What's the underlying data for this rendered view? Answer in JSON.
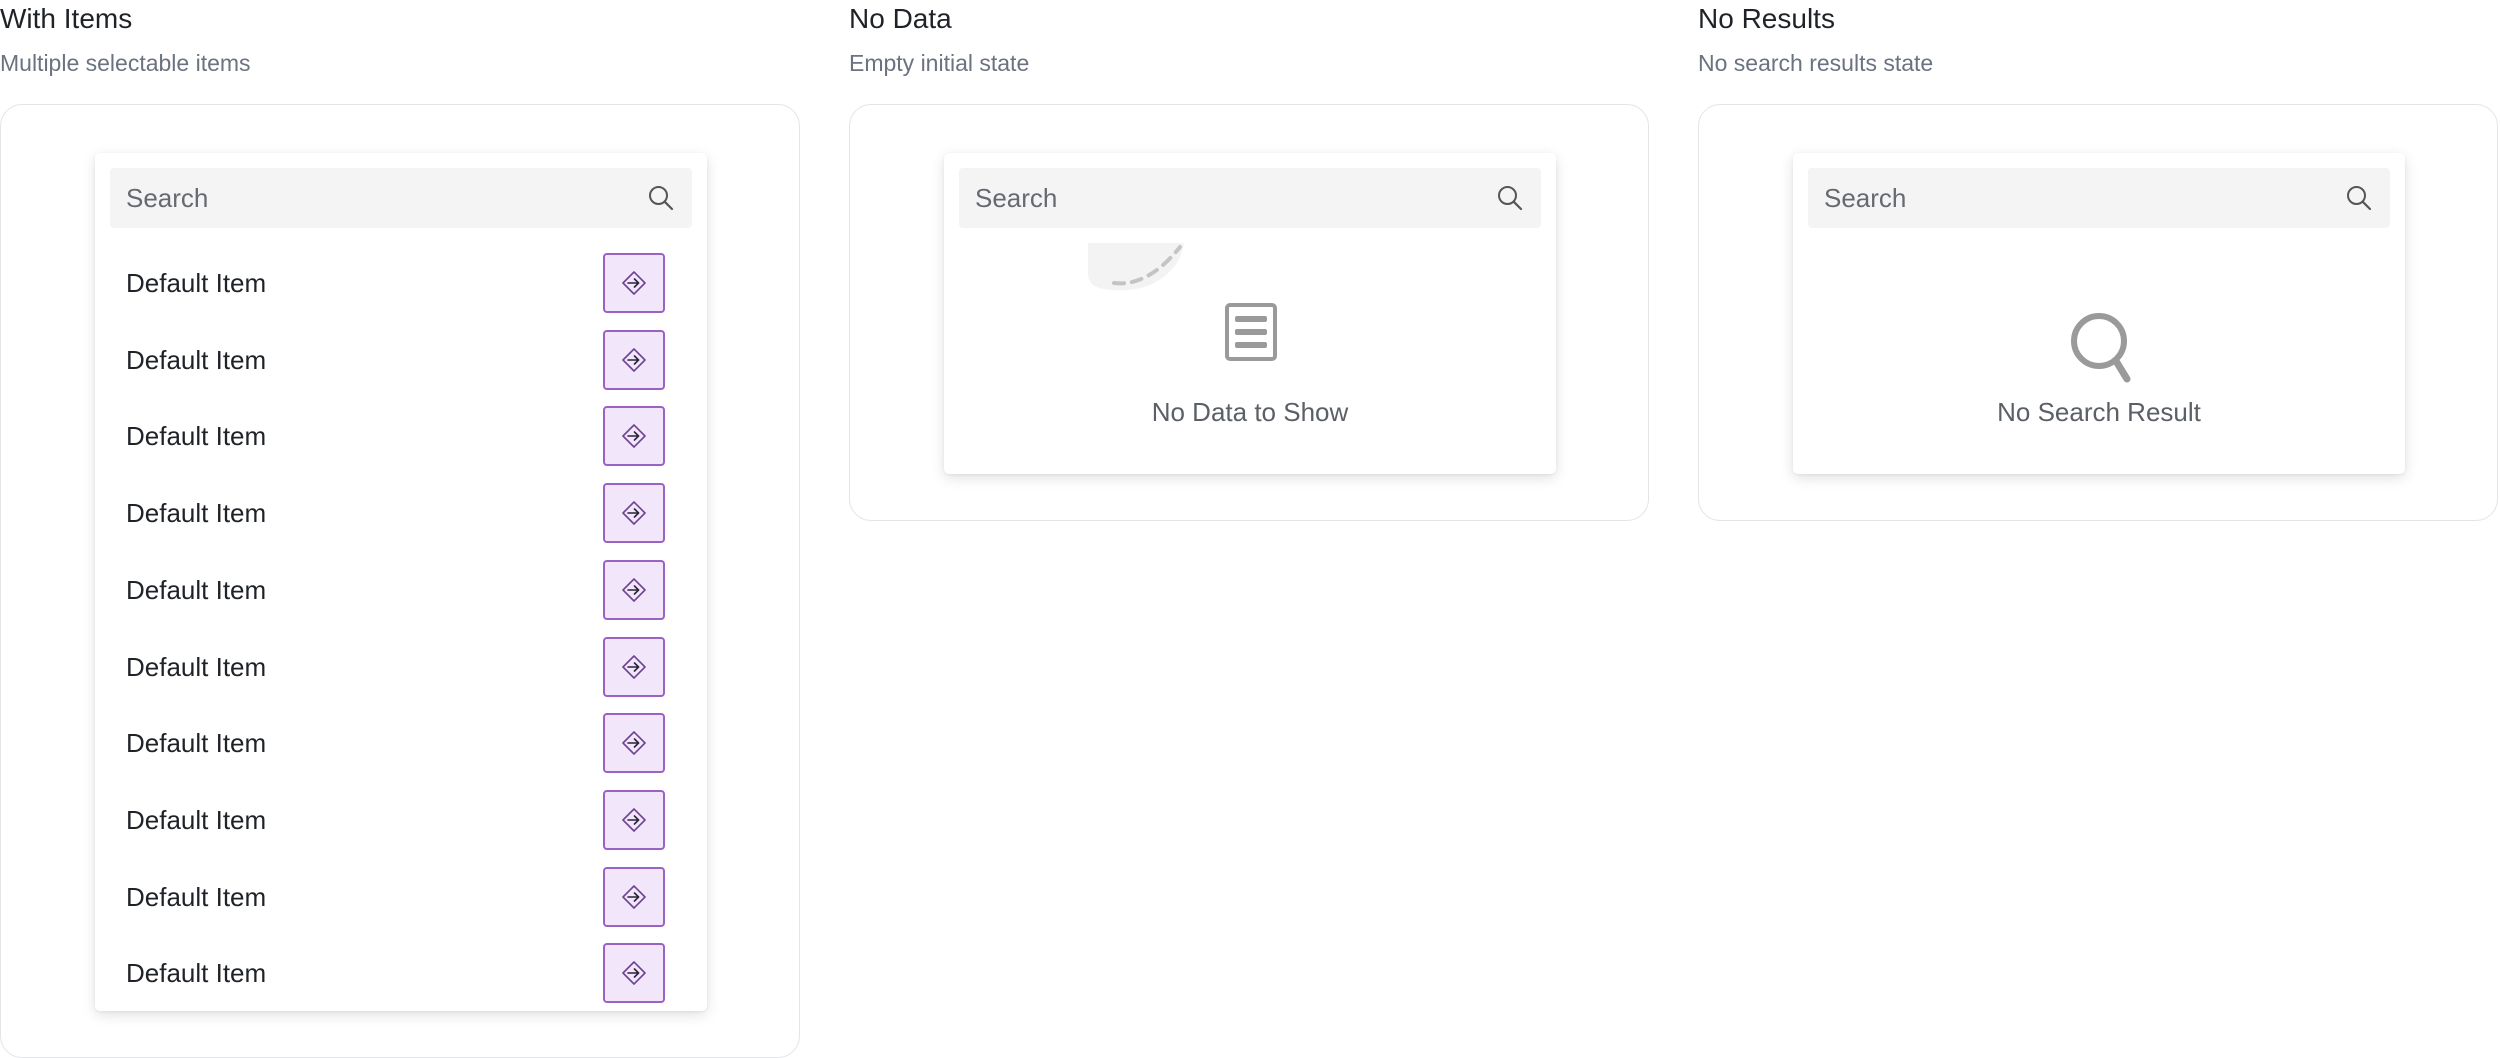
{
  "columns": [
    {
      "title": "With Items",
      "subtitle": "Multiple selectable items",
      "search_placeholder": "Search",
      "items": [
        {
          "label": "Default Item"
        },
        {
          "label": "Default Item"
        },
        {
          "label": "Default Item"
        },
        {
          "label": "Default Item"
        },
        {
          "label": "Default Item"
        },
        {
          "label": "Default Item"
        },
        {
          "label": "Default Item"
        },
        {
          "label": "Default Item"
        },
        {
          "label": "Default Item"
        },
        {
          "label": "Default Item"
        }
      ],
      "item_action_icon": "arrow-enter-icon"
    },
    {
      "title": "No Data",
      "subtitle": "Empty initial state",
      "search_placeholder": "Search",
      "empty_icon": "document-lines-icon",
      "empty_message": "No Data to Show"
    },
    {
      "title": "No Results",
      "subtitle": "No search results state",
      "search_placeholder": "Search",
      "empty_icon": "magnifier-icon",
      "empty_message": "No Search Result"
    }
  ],
  "colors": {
    "accent_border": "#9a62c4",
    "accent_fill": "#f2e6fb",
    "muted_icon": "#9a9a9a",
    "search_bg": "#f4f4f5"
  }
}
